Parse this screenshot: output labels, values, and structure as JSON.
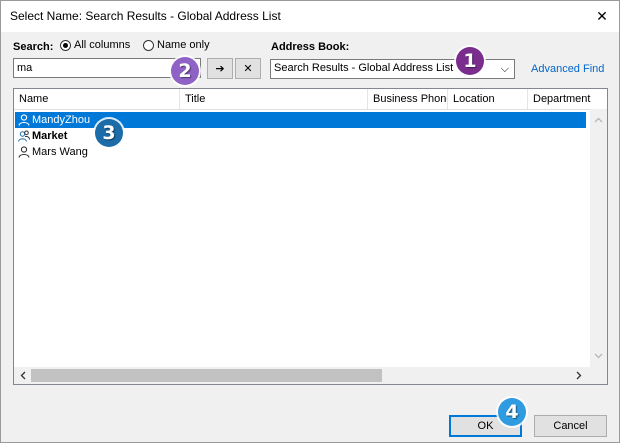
{
  "window": {
    "title": "Select Name: Search Results - Global Address List",
    "close_glyph": "✕"
  },
  "search": {
    "label": "Search:",
    "radio_all": "All columns",
    "radio_name": "Name only",
    "input_value": "ma",
    "go_glyph": "➔",
    "clear_glyph": "✕"
  },
  "address_book": {
    "label": "Address Book:",
    "selected": "Search Results - Global Address List",
    "arrow": "⌵",
    "advanced_find": "Advanced Find"
  },
  "list": {
    "columns": [
      "Name",
      "Title",
      "Business Phone",
      "Location",
      "Department"
    ],
    "rows": [
      {
        "name": "MandyZhou",
        "icon": "user-icon",
        "selected": true,
        "bold": false
      },
      {
        "name": "Market",
        "icon": "group-icon",
        "selected": false,
        "bold": true
      },
      {
        "name": "Mars Wang",
        "icon": "user-icon",
        "selected": false,
        "bold": false
      }
    ]
  },
  "buttons": {
    "ok": "OK",
    "cancel": "Cancel"
  },
  "badges": [
    {
      "num": "1",
      "color": "#7b2d8e"
    },
    {
      "num": "2",
      "color": "#8e63c5"
    },
    {
      "num": "3",
      "color": "#1b6ca8"
    },
    {
      "num": "4",
      "color": "#2f9be0"
    }
  ],
  "colors": {
    "selection": "#0078d7",
    "link": "#0066cc"
  }
}
